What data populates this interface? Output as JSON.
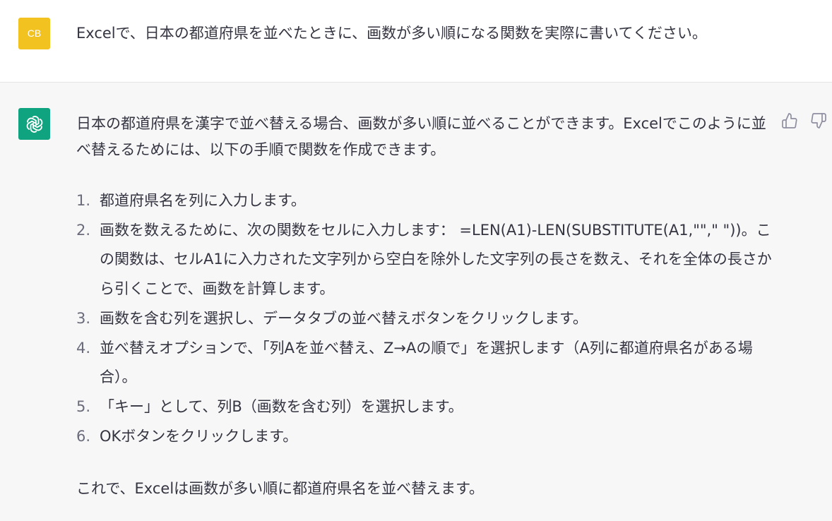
{
  "user": {
    "avatar_initials": "CB",
    "avatar_color": "#f2c320",
    "message": "Excelで、日本の都道府県を並べたときに、画数が多い順になる関数を実際に書いてください。"
  },
  "assistant": {
    "avatar_color": "#10a37f",
    "avatar_icon": "openai-logo-icon",
    "intro": "日本の都道府県を漢字で並べ替える場合、画数が多い順に並べることができます。Excelでこのように並べ替えるためには、以下の手順で関数を作成できます。",
    "steps": [
      {
        "num": "1.",
        "text": "都道府県名を列に入力します。"
      },
      {
        "num": "2.",
        "text": "画数を数えるために、次の関数をセルに入力します： =LEN(A1)-LEN(SUBSTITUTE(A1,\"\",\" \"))。この関数は、セルA1に入力された文字列から空白を除外した文字列の長さを数え、それを全体の長さから引くことで、画数を計算します。"
      },
      {
        "num": "3.",
        "text": "画数を含む列を選択し、データタブの並べ替えボタンをクリックします。"
      },
      {
        "num": "4.",
        "text": "並べ替えオプションで、「列Aを並べ替え、Z→Aの順で」を選択します（A列に都道府県名がある場合）。"
      },
      {
        "num": "5.",
        "text": "「キー」として、列B（画数を含む列）を選択します。"
      },
      {
        "num": "6.",
        "text": "OKボタンをクリックします。"
      }
    ],
    "outro": "これで、Excelは画数が多い順に都道府県名を並べ替えます。",
    "actions": {
      "thumb_up_icon": "thumbs-up-icon",
      "thumb_down_icon": "thumbs-down-icon"
    }
  }
}
